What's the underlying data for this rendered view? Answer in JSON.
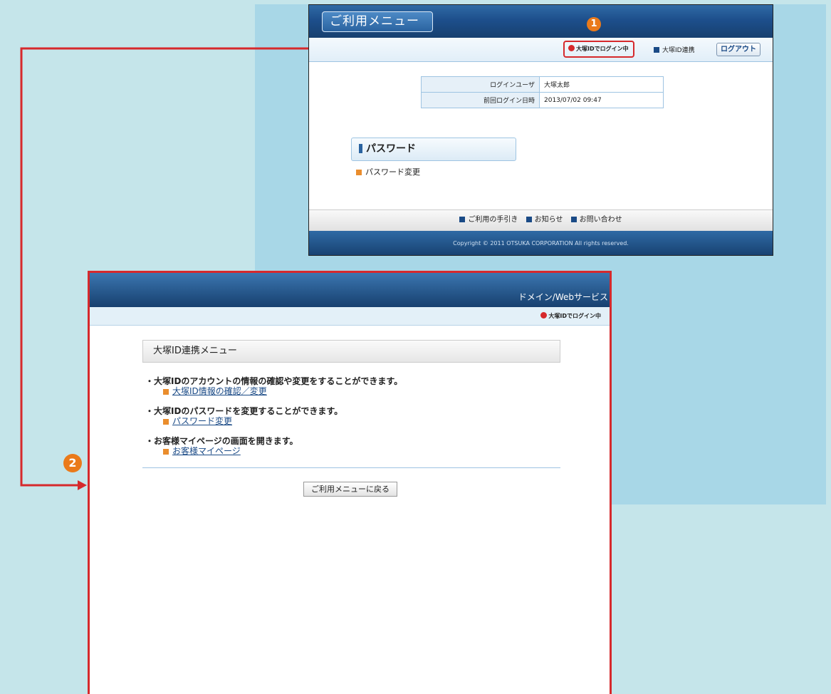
{
  "colors": {
    "accent_red": "#d6292c",
    "badge_orange": "#ea7a1a",
    "header_blue": "#1d4f8c"
  },
  "callouts": {
    "one": "1",
    "two": "2"
  },
  "top_window": {
    "title": "ご利用メニュー",
    "login_status": "大塚IDでログイン中",
    "otsuka_link": "大塚ID連携",
    "logout": "ログアウト",
    "info": [
      {
        "label": "ログインユーザ",
        "value": "大塚太郎"
      },
      {
        "label": "前回ログイン日時",
        "value": "2013/07/02 09:47"
      }
    ],
    "password_section": "パスワード",
    "password_change": "パスワード変更",
    "footer_links": [
      "ご利用の手引き",
      "お知らせ",
      "お問い合わせ"
    ],
    "copyright": "Copyright © 2011 OTSUKA CORPORATION All rights reserved."
  },
  "bottom_window": {
    "service_title": "ドメイン/Webサービス",
    "login_status": "大塚IDでログイン中",
    "menu_title": "大塚ID連携メニュー",
    "items": [
      {
        "description": "・大塚IDのアカウントの情報の確認や変更をすることができます。",
        "link": "大塚ID情報の確認／変更"
      },
      {
        "description": "・大塚IDのパスワードを変更することができます。",
        "link": "パスワード変更"
      },
      {
        "description": "・お客様マイページの画面を開きます。",
        "link": "お客様マイページ"
      }
    ],
    "back_button": "ご利用メニューに戻る"
  }
}
